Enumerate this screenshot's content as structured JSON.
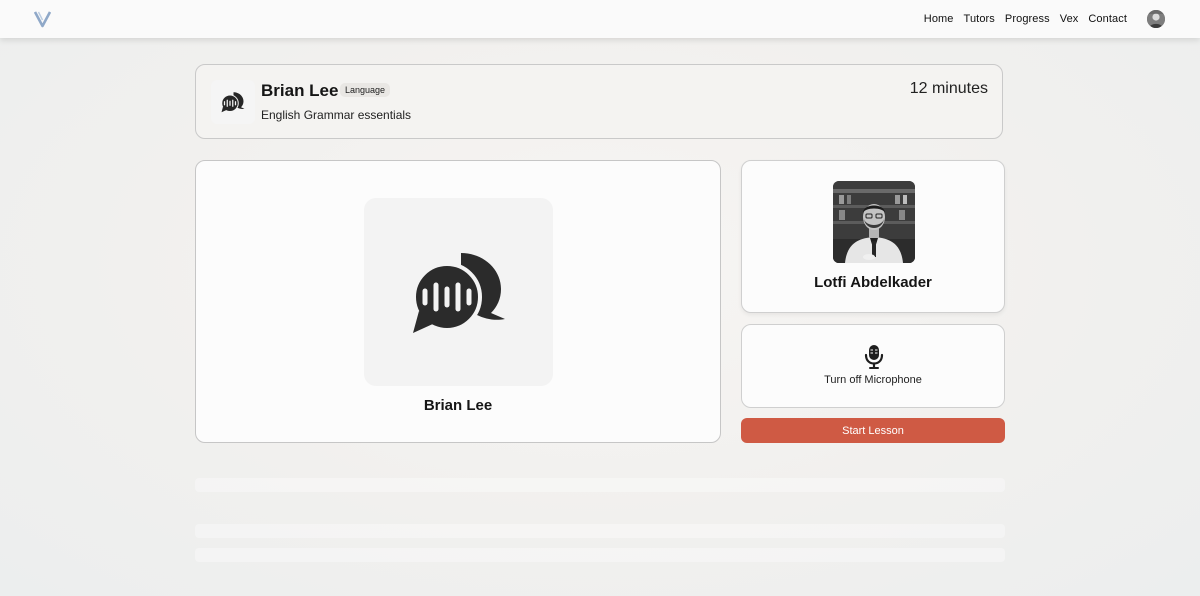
{
  "nav": {
    "links": [
      "Home",
      "Tutors",
      "Progress",
      "Vex",
      "Contact"
    ],
    "logo_icon": "v-logo-icon",
    "avatar_icon": "user-avatar"
  },
  "lesson": {
    "student_name": "Brian Lee",
    "category_badge": "Language",
    "subject": "English Grammar essentials",
    "duration": "12 minutes",
    "icon": "speech-bubbles-audio-icon"
  },
  "main_panel": {
    "participant_name": "Brian Lee",
    "icon": "speech-bubbles-audio-icon"
  },
  "tutor": {
    "name": "Lotfi Abdelkader",
    "photo": "tutor-photo"
  },
  "microphone": {
    "label": "Turn off Microphone",
    "icon": "microphone-icon"
  },
  "actions": {
    "start_label": "Start Lesson"
  },
  "colors": {
    "accent": "#cf5a44",
    "logo": "#8fa8c8",
    "text": "#151515"
  }
}
